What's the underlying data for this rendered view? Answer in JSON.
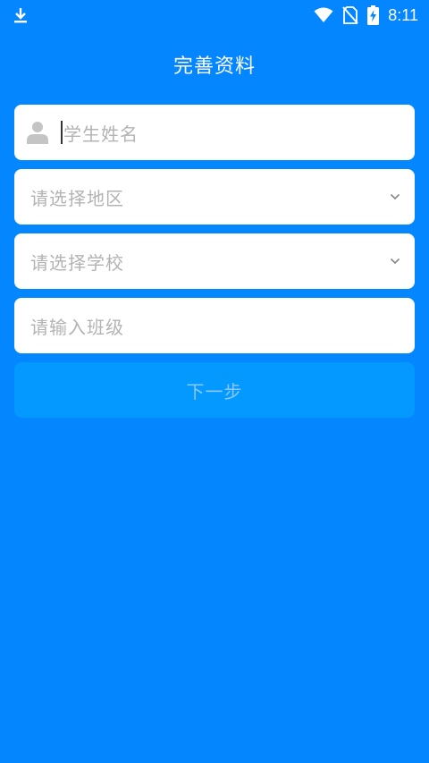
{
  "status_bar": {
    "time": "8:11",
    "icons": [
      "download-icon",
      "wifi-icon",
      "no-sim-icon",
      "battery-charging-icon"
    ]
  },
  "header": {
    "title": "完善资料"
  },
  "form": {
    "student_name_placeholder": "学生姓名",
    "region_placeholder": "请选择地区",
    "school_placeholder": "请选择学校",
    "class_placeholder": "请输入班级",
    "next_label": "下一步"
  },
  "colors": {
    "background": "#0386FF",
    "button": "#0499FF",
    "button_text": "#8CC8FF",
    "placeholder": "#B3B3B3"
  }
}
